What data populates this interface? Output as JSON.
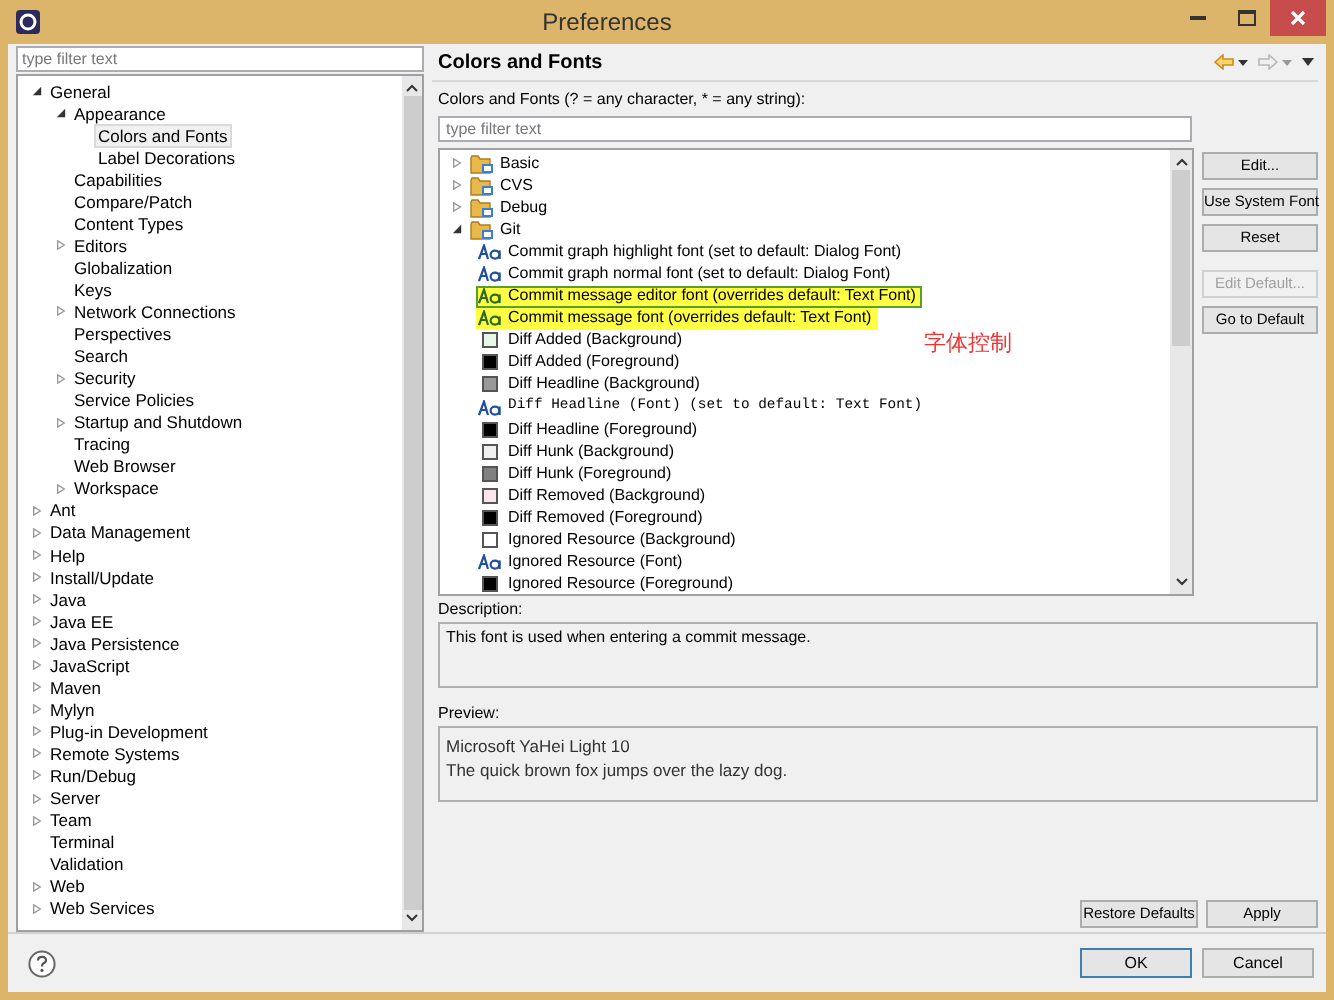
{
  "window": {
    "title": "Preferences"
  },
  "sidebar": {
    "filter": {
      "placeholder": "type filter text"
    },
    "tree": [
      {
        "label": "General",
        "expanded": true,
        "selected": false,
        "children": [
          {
            "label": "Appearance",
            "expanded": true,
            "selected": false,
            "children": [
              {
                "label": "Colors and Fonts",
                "selected": true
              },
              {
                "label": "Label Decorations",
                "selected": false
              }
            ]
          },
          {
            "label": "Capabilities",
            "selected": false
          },
          {
            "label": "Compare/Patch",
            "selected": false
          },
          {
            "label": "Content Types",
            "selected": false
          },
          {
            "label": "Editors",
            "expanded": false,
            "selected": false
          },
          {
            "label": "Globalization",
            "selected": false
          },
          {
            "label": "Keys",
            "selected": false
          },
          {
            "label": "Network Connections",
            "expanded": false,
            "selected": false
          },
          {
            "label": "Perspectives",
            "selected": false
          },
          {
            "label": "Search",
            "selected": false
          },
          {
            "label": "Security",
            "expanded": false,
            "selected": false
          },
          {
            "label": "Service Policies",
            "selected": false
          },
          {
            "label": "Startup and Shutdown",
            "expanded": false,
            "selected": false
          },
          {
            "label": "Tracing",
            "selected": false
          },
          {
            "label": "Web Browser",
            "selected": false
          },
          {
            "label": "Workspace",
            "expanded": false,
            "selected": false
          }
        ]
      },
      {
        "label": "Ant",
        "expanded": false,
        "selected": false
      },
      {
        "label": "Data Management",
        "expanded": false,
        "selected": false
      },
      {
        "label": "Help",
        "expanded": false,
        "selected": false
      },
      {
        "label": "Install/Update",
        "expanded": false,
        "selected": false
      },
      {
        "label": "Java",
        "expanded": false,
        "selected": false
      },
      {
        "label": "Java EE",
        "expanded": false,
        "selected": false
      },
      {
        "label": "Java Persistence",
        "expanded": false,
        "selected": false
      },
      {
        "label": "JavaScript",
        "expanded": false,
        "selected": false
      },
      {
        "label": "Maven",
        "expanded": false,
        "selected": false
      },
      {
        "label": "Mylyn",
        "expanded": false,
        "selected": false
      },
      {
        "label": "Plug-in Development",
        "expanded": false,
        "selected": false
      },
      {
        "label": "Remote Systems",
        "expanded": false,
        "selected": false
      },
      {
        "label": "Run/Debug",
        "expanded": false,
        "selected": false
      },
      {
        "label": "Server",
        "expanded": false,
        "selected": false
      },
      {
        "label": "Team",
        "expanded": false,
        "selected": false
      },
      {
        "label": "Terminal",
        "selected": false
      },
      {
        "label": "Validation",
        "selected": false
      },
      {
        "label": "Web",
        "expanded": false,
        "selected": false
      },
      {
        "label": "Web Services",
        "expanded": false,
        "selected": false
      }
    ]
  },
  "page": {
    "title": "Colors and Fonts",
    "filter_label": "Colors and Fonts (? = any character, * = any string):",
    "filter": {
      "placeholder": "type filter text"
    },
    "items": [
      {
        "kind": "category",
        "label": "Basic",
        "expanded": false,
        "selected": false
      },
      {
        "kind": "category",
        "label": "CVS",
        "expanded": false,
        "selected": false
      },
      {
        "kind": "category",
        "label": "Debug",
        "expanded": false,
        "selected": false
      },
      {
        "kind": "category",
        "label": "Git",
        "expanded": true,
        "selected": false,
        "children": [
          {
            "kind": "font",
            "label": "Commit graph highlight font (set to default: Dialog Font)",
            "selected": false,
            "highlighted": false,
            "monospace": false
          },
          {
            "kind": "font",
            "label": "Commit graph normal font (set to default: Dialog Font)",
            "selected": false,
            "highlighted": false,
            "monospace": false
          },
          {
            "kind": "font",
            "label": "Commit message editor font (overrides default: Text Font)",
            "selected": true,
            "highlighted": true,
            "monospace": false
          },
          {
            "kind": "font",
            "label": "Commit message font (overrides default: Text Font)",
            "selected": false,
            "highlighted": true,
            "monospace": false
          },
          {
            "kind": "color",
            "label": "Diff Added (Background)",
            "color": "#e8f8e8",
            "selected": false
          },
          {
            "kind": "color",
            "label": "Diff Added (Foreground)",
            "color": "#000000",
            "selected": false
          },
          {
            "kind": "color",
            "label": "Diff Headline (Background)",
            "color": "#999999",
            "selected": false
          },
          {
            "kind": "font",
            "label": "Diff Headline (Font) (set to default: Text Font)",
            "selected": false,
            "highlighted": false,
            "monospace": true
          },
          {
            "kind": "color",
            "label": "Diff Headline (Foreground)",
            "color": "#000000",
            "selected": false
          },
          {
            "kind": "color",
            "label": "Diff Hunk (Background)",
            "color": "#f0f0f0",
            "selected": false
          },
          {
            "kind": "color",
            "label": "Diff Hunk (Foreground)",
            "color": "#808080",
            "selected": false
          },
          {
            "kind": "color",
            "label": "Diff Removed (Background)",
            "color": "#fae6ea",
            "selected": false
          },
          {
            "kind": "color",
            "label": "Diff Removed (Foreground)",
            "color": "#000000",
            "selected": false
          },
          {
            "kind": "color",
            "label": "Ignored Resource (Background)",
            "color": "#ffffff",
            "selected": false
          },
          {
            "kind": "font",
            "label": "Ignored Resource (Font)",
            "selected": false,
            "highlighted": false,
            "monospace": false
          },
          {
            "kind": "color",
            "label": "Ignored Resource (Foreground)",
            "color": "#000000",
            "selected": false
          }
        ]
      }
    ],
    "buttons": [
      {
        "label": "Edit...",
        "disabled": false
      },
      {
        "label": "Use System Font",
        "disabled": false
      },
      {
        "label": "Reset",
        "disabled": false
      },
      {
        "label": "Edit Default...",
        "disabled": true
      },
      {
        "label": "Go to Default",
        "disabled": false
      }
    ],
    "annotation": "字体控制",
    "description": {
      "label": "Description:",
      "text": "This font is used when entering a commit message."
    },
    "preview": {
      "label": "Preview:",
      "lines": [
        "Microsoft YaHei Light 10",
        "The quick brown fox jumps over the lazy dog."
      ]
    },
    "actions": [
      "Restore Defaults",
      "Apply"
    ]
  },
  "footer": {
    "buttons": [
      {
        "label": "OK",
        "default": true
      },
      {
        "label": "Cancel",
        "default": false
      }
    ]
  }
}
